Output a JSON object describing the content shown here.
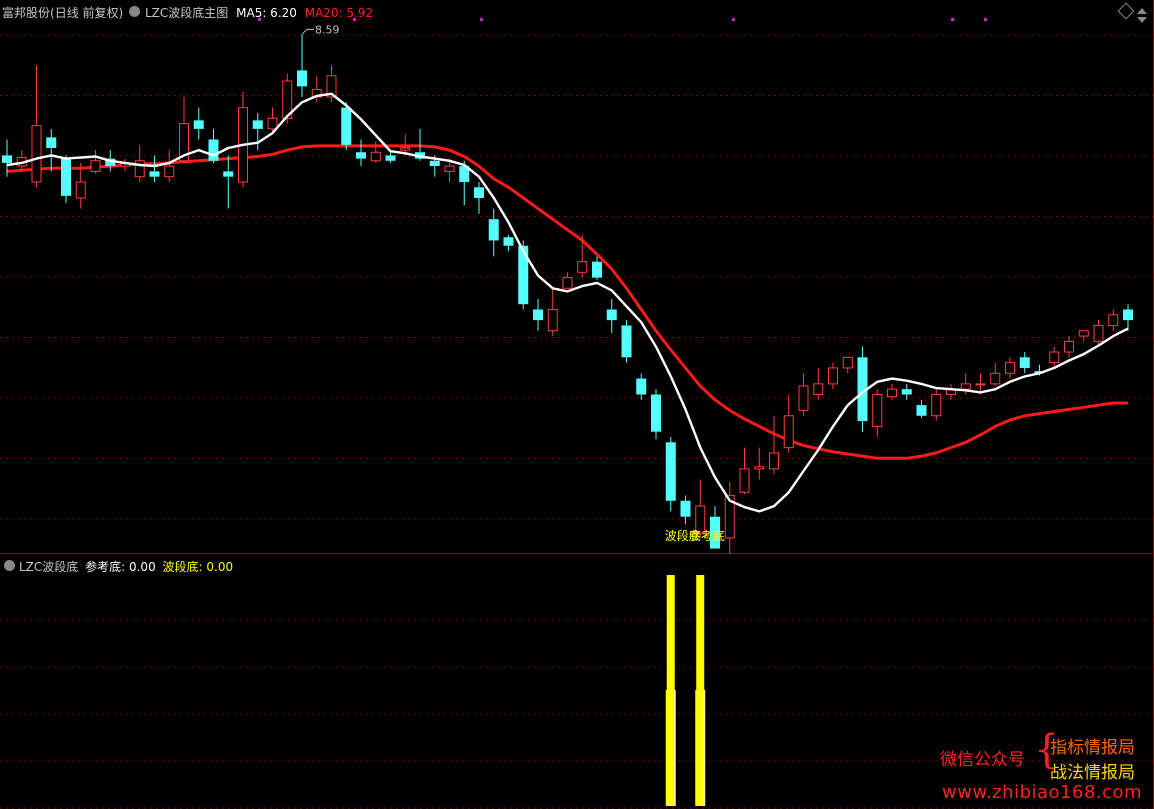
{
  "main_header": {
    "stock_name": "富邦股份",
    "period": "(日线 前复权)",
    "indicator_name": "LZC波段底主图",
    "ma5_label": "MA5: 6.20",
    "ma20_label": "MA20: 5.92"
  },
  "sub_header": {
    "indicator_name": "LZC波段底",
    "ref_label": "参考底: 0.00",
    "wave_label": "波段底: 0.00"
  },
  "watermark": {
    "wechat_label": "微信公众号",
    "line1": "指标情报局",
    "line2": "战法情报局",
    "url": "www.zhibiao168.com"
  },
  "colors": {
    "background": "#000000",
    "up_candle": "#ff3d3d",
    "down_candle": "#54ffff",
    "ma5": "#ffffff",
    "ma20": "#ff1a1a",
    "signal_bar": "#ffff00",
    "signal_text": "#ffff00",
    "grid": "#800000",
    "header_text": "#c0c0c0",
    "watermark_red": "#ff2020",
    "watermark_yellow": "#ffd700"
  },
  "chart_data": [
    {
      "type": "candlestick",
      "title": "LZC波段底主图",
      "ylim": [
        4.0,
        8.8
      ],
      "high_annotation": "8.59",
      "signal_labels": [
        "波段底",
        "参考底"
      ],
      "candles": [
        [
          7.45,
          7.38,
          7.6,
          7.25
        ],
        [
          7.35,
          7.43,
          7.5,
          7.3
        ],
        [
          7.2,
          7.73,
          8.3,
          7.15
        ],
        [
          7.62,
          7.52,
          7.7,
          7.3
        ],
        [
          7.42,
          7.07,
          7.45,
          7.0
        ],
        [
          7.05,
          7.2,
          7.38,
          6.95
        ],
        [
          7.3,
          7.4,
          7.5,
          7.28
        ],
        [
          7.42,
          7.35,
          7.5,
          7.3
        ],
        [
          7.35,
          7.37,
          7.42,
          7.3
        ],
        [
          7.25,
          7.4,
          7.55,
          7.2
        ],
        [
          7.3,
          7.25,
          7.45,
          7.2
        ],
        [
          7.25,
          7.35,
          7.5,
          7.2
        ],
        [
          7.4,
          7.75,
          8.0,
          7.38
        ],
        [
          7.78,
          7.7,
          7.9,
          7.6
        ],
        [
          7.6,
          7.4,
          7.7,
          7.38
        ],
        [
          7.3,
          7.25,
          7.45,
          6.95
        ],
        [
          7.2,
          7.9,
          8.05,
          7.15
        ],
        [
          7.78,
          7.7,
          7.85,
          7.5
        ],
        [
          7.7,
          7.8,
          7.9,
          7.65
        ],
        [
          7.8,
          8.15,
          8.22,
          7.75
        ],
        [
          8.25,
          8.1,
          8.59,
          8.0
        ],
        [
          8.0,
          8.07,
          8.2,
          7.95
        ],
        [
          8.0,
          8.2,
          8.3,
          7.95
        ],
        [
          7.9,
          7.55,
          7.95,
          7.5
        ],
        [
          7.48,
          7.42,
          7.6,
          7.35
        ],
        [
          7.4,
          7.48,
          7.58,
          7.38
        ],
        [
          7.45,
          7.4,
          7.5,
          7.38
        ],
        [
          7.5,
          7.52,
          7.65,
          7.45
        ],
        [
          7.48,
          7.42,
          7.7,
          7.4
        ],
        [
          7.4,
          7.35,
          7.45,
          7.25
        ],
        [
          7.3,
          7.35,
          7.42,
          7.2
        ],
        [
          7.35,
          7.2,
          7.4,
          6.98
        ],
        [
          7.15,
          7.05,
          7.2,
          6.9
        ],
        [
          6.85,
          6.65,
          6.95,
          6.5
        ],
        [
          6.68,
          6.6,
          6.7,
          6.55
        ],
        [
          6.6,
          6.05,
          6.65,
          6.0
        ],
        [
          6.0,
          5.9,
          6.1,
          5.8
        ],
        [
          5.8,
          6.0,
          6.2,
          5.75
        ],
        [
          6.2,
          6.3,
          6.35,
          6.2
        ],
        [
          6.35,
          6.45,
          6.7,
          6.3
        ],
        [
          6.45,
          6.3,
          6.5,
          6.28
        ],
        [
          6.0,
          5.9,
          6.1,
          5.78
        ],
        [
          5.85,
          5.55,
          5.9,
          5.5
        ],
        [
          5.35,
          5.2,
          5.4,
          5.15
        ],
        [
          5.2,
          4.85,
          5.25,
          4.78
        ],
        [
          4.75,
          4.2,
          4.8,
          4.1
        ],
        [
          4.2,
          4.05,
          4.25,
          3.98
        ],
        [
          3.9,
          4.15,
          4.4,
          3.85
        ],
        [
          4.05,
          3.75,
          4.15,
          3.75
        ],
        [
          3.85,
          4.25,
          4.38,
          3.7
        ],
        [
          4.28,
          4.5,
          4.7,
          4.26
        ],
        [
          4.5,
          4.52,
          4.7,
          4.4
        ],
        [
          4.5,
          4.65,
          5.0,
          4.45
        ],
        [
          4.7,
          5.0,
          5.2,
          4.65
        ],
        [
          5.05,
          5.28,
          5.4,
          5.0
        ],
        [
          5.2,
          5.3,
          5.45,
          5.15
        ],
        [
          5.3,
          5.45,
          5.5,
          5.25
        ],
        [
          5.45,
          5.55,
          5.55,
          5.4
        ],
        [
          5.55,
          4.95,
          5.65,
          4.85
        ],
        [
          4.9,
          5.2,
          5.25,
          4.8
        ],
        [
          5.18,
          5.25,
          5.3,
          5.15
        ],
        [
          5.25,
          5.2,
          5.3,
          5.15
        ],
        [
          5.1,
          5.0,
          5.15,
          4.98
        ],
        [
          5.0,
          5.2,
          5.25,
          4.95
        ],
        [
          5.2,
          5.25,
          5.3,
          5.15
        ],
        [
          5.25,
          5.3,
          5.4,
          5.2
        ],
        [
          5.3,
          5.3,
          5.4,
          5.2
        ],
        [
          5.3,
          5.4,
          5.5,
          5.28
        ],
        [
          5.4,
          5.5,
          5.55,
          5.35
        ],
        [
          5.55,
          5.45,
          5.6,
          5.4
        ],
        [
          5.42,
          5.4,
          5.48,
          5.38
        ],
        [
          5.5,
          5.6,
          5.65,
          5.45
        ],
        [
          5.6,
          5.7,
          5.75,
          5.55
        ],
        [
          5.75,
          5.8,
          5.8,
          5.7
        ],
        [
          5.7,
          5.85,
          5.9,
          5.65
        ],
        [
          5.85,
          5.95,
          6.0,
          5.8
        ],
        [
          6.0,
          5.9,
          6.05,
          5.8
        ]
      ],
      "ma5": [
        7.36,
        7.38,
        7.42,
        7.45,
        7.42,
        7.43,
        7.44,
        7.4,
        7.38,
        7.36,
        7.35,
        7.38,
        7.45,
        7.5,
        7.45,
        7.52,
        7.55,
        7.57,
        7.66,
        7.82,
        7.95,
        8.01,
        8.03,
        7.92,
        7.79,
        7.64,
        7.49,
        7.47,
        7.44,
        7.42,
        7.4,
        7.36,
        7.25,
        7.05,
        6.82,
        6.55,
        6.32,
        6.2,
        6.17,
        6.22,
        6.25,
        6.18,
        6.03,
        5.88,
        5.65,
        5.37,
        5.06,
        4.7,
        4.42,
        4.2,
        4.14,
        4.1,
        4.15,
        4.28,
        4.48,
        4.68,
        4.9,
        5.1,
        5.22,
        5.32,
        5.35,
        5.33,
        5.3,
        5.26,
        5.25,
        5.24,
        5.22,
        5.25,
        5.32,
        5.37,
        5.4,
        5.45,
        5.52,
        5.58,
        5.66,
        5.75,
        5.82
      ],
      "ma20": [
        7.3,
        7.31,
        7.32,
        7.33,
        7.33,
        7.33,
        7.34,
        7.35,
        7.36,
        7.37,
        7.37,
        7.38,
        7.39,
        7.4,
        7.41,
        7.42,
        7.43,
        7.44,
        7.46,
        7.5,
        7.53,
        7.54,
        7.54,
        7.54,
        7.54,
        7.54,
        7.54,
        7.54,
        7.54,
        7.53,
        7.5,
        7.44,
        7.35,
        7.23,
        7.15,
        7.05,
        6.95,
        6.85,
        6.75,
        6.65,
        6.52,
        6.38,
        6.2,
        6.0,
        5.8,
        5.62,
        5.45,
        5.28,
        5.15,
        5.05,
        4.97,
        4.9,
        4.83,
        4.77,
        4.72,
        4.69,
        4.66,
        4.64,
        4.62,
        4.6,
        4.6,
        4.6,
        4.62,
        4.65,
        4.7,
        4.75,
        4.82,
        4.9,
        4.96,
        5.0,
        5.02,
        5.04,
        5.06,
        5.08,
        5.1,
        5.12,
        5.12
      ]
    },
    {
      "type": "bar",
      "title": "LZC波段底",
      "series": [
        {
          "name": "参考底",
          "values": [
            0,
            0,
            0,
            0,
            0,
            0,
            0,
            0,
            0,
            0,
            0,
            0,
            0,
            0,
            0,
            0,
            0,
            0,
            0,
            0,
            0,
            0,
            0,
            0,
            0,
            0,
            0,
            0,
            0,
            0,
            0,
            0,
            0,
            0,
            0,
            0,
            0,
            0,
            0,
            0,
            0,
            0,
            0,
            0,
            0,
            1,
            0,
            1,
            0,
            0,
            0,
            0,
            0,
            0,
            0,
            0,
            0,
            0,
            0,
            0,
            0,
            0,
            0,
            0,
            0,
            0,
            0,
            0,
            0,
            0,
            0,
            0,
            0,
            0,
            0,
            0,
            0
          ]
        },
        {
          "name": "波段底",
          "values": [
            0,
            0,
            0,
            0,
            0,
            0,
            0,
            0,
            0,
            0,
            0,
            0,
            0,
            0,
            0,
            0,
            0,
            0,
            0,
            0,
            0,
            0,
            0,
            0,
            0,
            0,
            0,
            0,
            0,
            0,
            0,
            0,
            0,
            0,
            0,
            0,
            0,
            0,
            0,
            0,
            0,
            0,
            0,
            0,
            0,
            1,
            0,
            1,
            0,
            0,
            0,
            0,
            0,
            0,
            0,
            0,
            0,
            0,
            0,
            0,
            0,
            0,
            0,
            0,
            0,
            0,
            0,
            0,
            0,
            0,
            0,
            0,
            0,
            0,
            0,
            0,
            0
          ]
        }
      ],
      "ylim": [
        0,
        1
      ]
    }
  ]
}
